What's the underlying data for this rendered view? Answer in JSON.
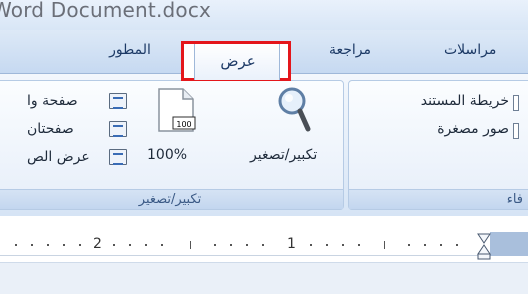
{
  "window": {
    "title": "Word Document.docx"
  },
  "tabs": {
    "developer": "المطور",
    "view": "عرض",
    "review": "مراجعة",
    "mailings": "مراسلات"
  },
  "groups": {
    "zoom": {
      "label": "تكبير/تصغير",
      "zoom_button": "تكبير/تصغير",
      "hundred_percent": "100%",
      "hundred_icon_text": "100",
      "one_page": "صفحة وا",
      "two_pages": "صفحتان",
      "page_width": "عرض الص"
    },
    "show_hide": {
      "label": "فاء",
      "document_map": "خريطة المستند",
      "thumbnails": "صور مصغرة"
    }
  },
  "ruler": {
    "labels": [
      "2",
      "1"
    ]
  },
  "colors": {
    "highlight": "#e4161b",
    "ribbon": "#dce8f6"
  }
}
